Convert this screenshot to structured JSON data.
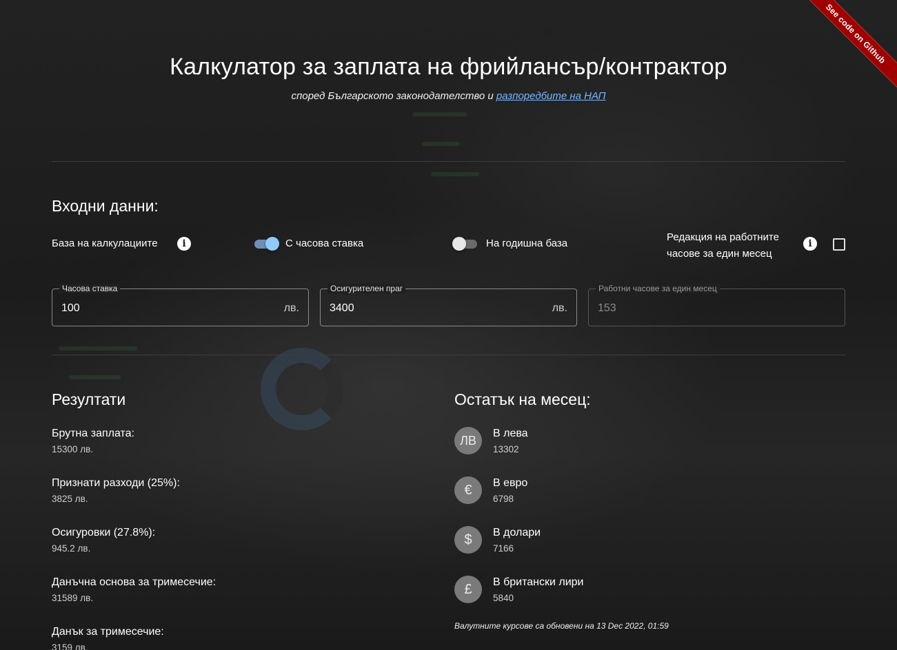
{
  "ribbon": {
    "label": "See code on Github"
  },
  "header": {
    "title": "Калкулатор за заплата на фрийлансър/контрактор",
    "subtitle_text": "според Българското законодателство и",
    "subtitle_link": "разпоредбите на НАП"
  },
  "inputs": {
    "section_title": "Входни данни:",
    "base_label": "База на калкулациите",
    "toggle_hourly_label": "С часова ставка",
    "toggle_hourly_on": true,
    "toggle_yearly_label": "На годишна база",
    "toggle_yearly_on": false,
    "edit_hours_label_line1": "Редакция на работните",
    "edit_hours_label_line2": "часове за един месец",
    "edit_hours_checked": false,
    "fields": [
      {
        "label": "Часова ставка",
        "value": "100",
        "suffix": "лв."
      },
      {
        "label": "Осигурителен праг",
        "value": "3400",
        "suffix": "лв."
      },
      {
        "label": "Работни часове за един месец",
        "value": "153",
        "suffix": ""
      }
    ]
  },
  "results": {
    "section_title": "Резултати",
    "items": [
      {
        "label": "Брутна заплата:",
        "value": "15300 лв."
      },
      {
        "label": "Признати разходи (25%):",
        "value": "3825 лв."
      },
      {
        "label": "Осигуровки (27.8%):",
        "value": "945.2 лв."
      },
      {
        "label": "Данъчна основа за тримесечие:",
        "value": "31589 лв."
      },
      {
        "label": "Данък за тримесечие:",
        "value": "3159 лв."
      }
    ]
  },
  "remainder": {
    "section_title": "Остатък на месец:",
    "items": [
      {
        "symbol": "ЛВ",
        "label": "В лева",
        "value": "13302"
      },
      {
        "symbol": "€",
        "label": "В евро",
        "value": "6798"
      },
      {
        "symbol": "$",
        "label": "В долари",
        "value": "7166"
      },
      {
        "symbol": "£",
        "label": "В британски лири",
        "value": "5840"
      }
    ],
    "rates_note": "Валутните курсове са обновени на 13 Dec 2022, 01:59"
  },
  "colors": {
    "background": "#1e1e1e",
    "link": "#79b7ff",
    "ribbon": "#a00000",
    "toggle_on_thumb": "#90caf9"
  }
}
